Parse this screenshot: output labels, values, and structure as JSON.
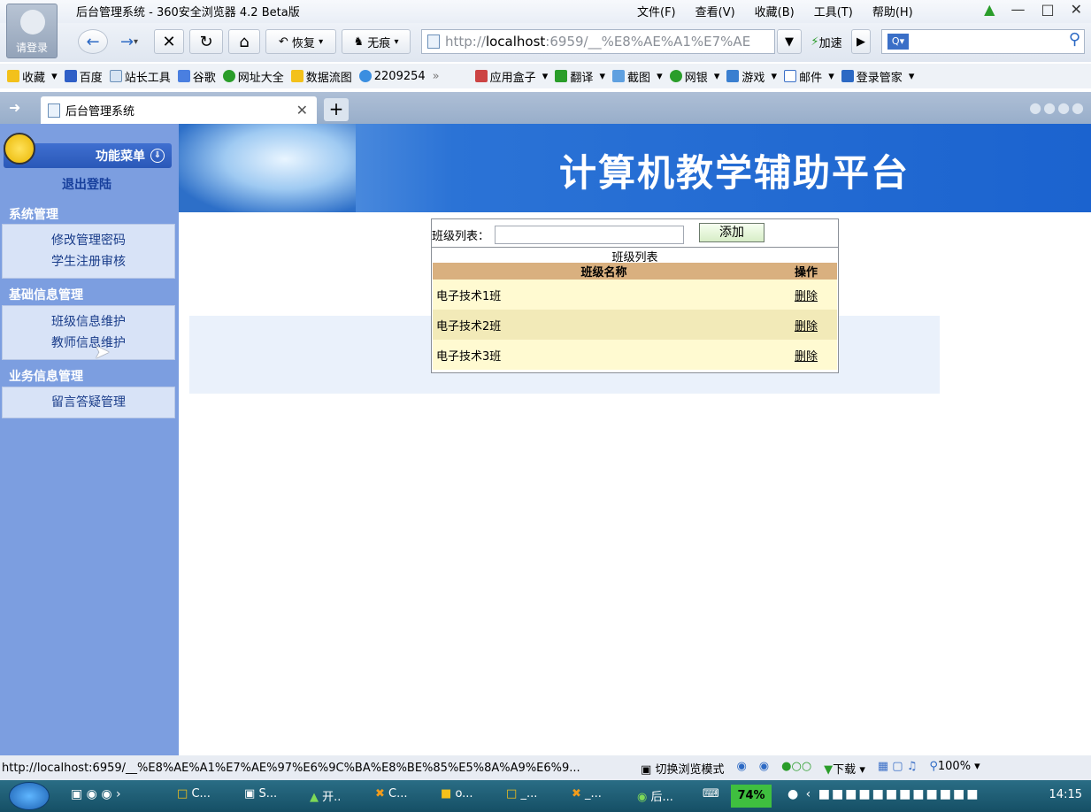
{
  "window": {
    "title": "后台管理系统 - 360安全浏览器 4.2 Beta版",
    "avatar_label": "请登录",
    "menu": [
      "文件(F)",
      "查看(V)",
      "收藏(B)",
      "工具(T)",
      "帮助(H)"
    ]
  },
  "nav": {
    "restore_label": "恢复",
    "private_label": "无痕",
    "address_gray": "http://",
    "address_host": "localhost",
    "address_rest": ":6959/__%E8%AE%A1%E7%AE",
    "accelerate_label": "加速"
  },
  "bookmarks": [
    "收藏",
    "百度",
    "站长工具",
    "谷歌",
    "网址大全",
    "数据流图",
    "2209254",
    "»",
    "应用盒子",
    "翻译",
    "截图",
    "网银",
    "游戏",
    "邮件",
    "登录管家"
  ],
  "tabs": [
    {
      "label": "后台管理系统"
    }
  ],
  "sidebar": {
    "header": "功能菜单",
    "logout": "退出登陆",
    "groups": [
      {
        "title": "系统管理",
        "items": [
          "修改管理密码",
          "学生注册审核"
        ]
      },
      {
        "title": "基础信息管理",
        "items": [
          "班级信息维护",
          "教师信息维护"
        ]
      },
      {
        "title": "业务信息管理",
        "items": [
          "留言答疑管理"
        ]
      }
    ]
  },
  "banner": {
    "title": "计算机教学辅助平台"
  },
  "panel": {
    "input_label": "班级列表：",
    "input_value": "",
    "add_label": "添加",
    "caption": "班级列表",
    "columns": [
      "班级名称",
      "操作"
    ],
    "rows": [
      {
        "name": "电子技术1班",
        "action": "删除"
      },
      {
        "name": "电子技术2班",
        "action": "删除"
      },
      {
        "name": "电子技术3班",
        "action": "删除"
      }
    ]
  },
  "status": {
    "url": "http://localhost:6959/__%E8%AE%A1%E7%AE%97%E6%9C%BA%E8%BE%85%E5%8A%A9%E6%9...",
    "switch_mode": "切换浏览模式",
    "download": "下载",
    "zoom": "100%"
  },
  "taskbar": {
    "items": [
      "C...",
      "S...",
      "开..",
      "C...",
      "o...",
      "_...",
      "_...",
      "后..."
    ],
    "battery": "74%",
    "clock": "14:15"
  }
}
